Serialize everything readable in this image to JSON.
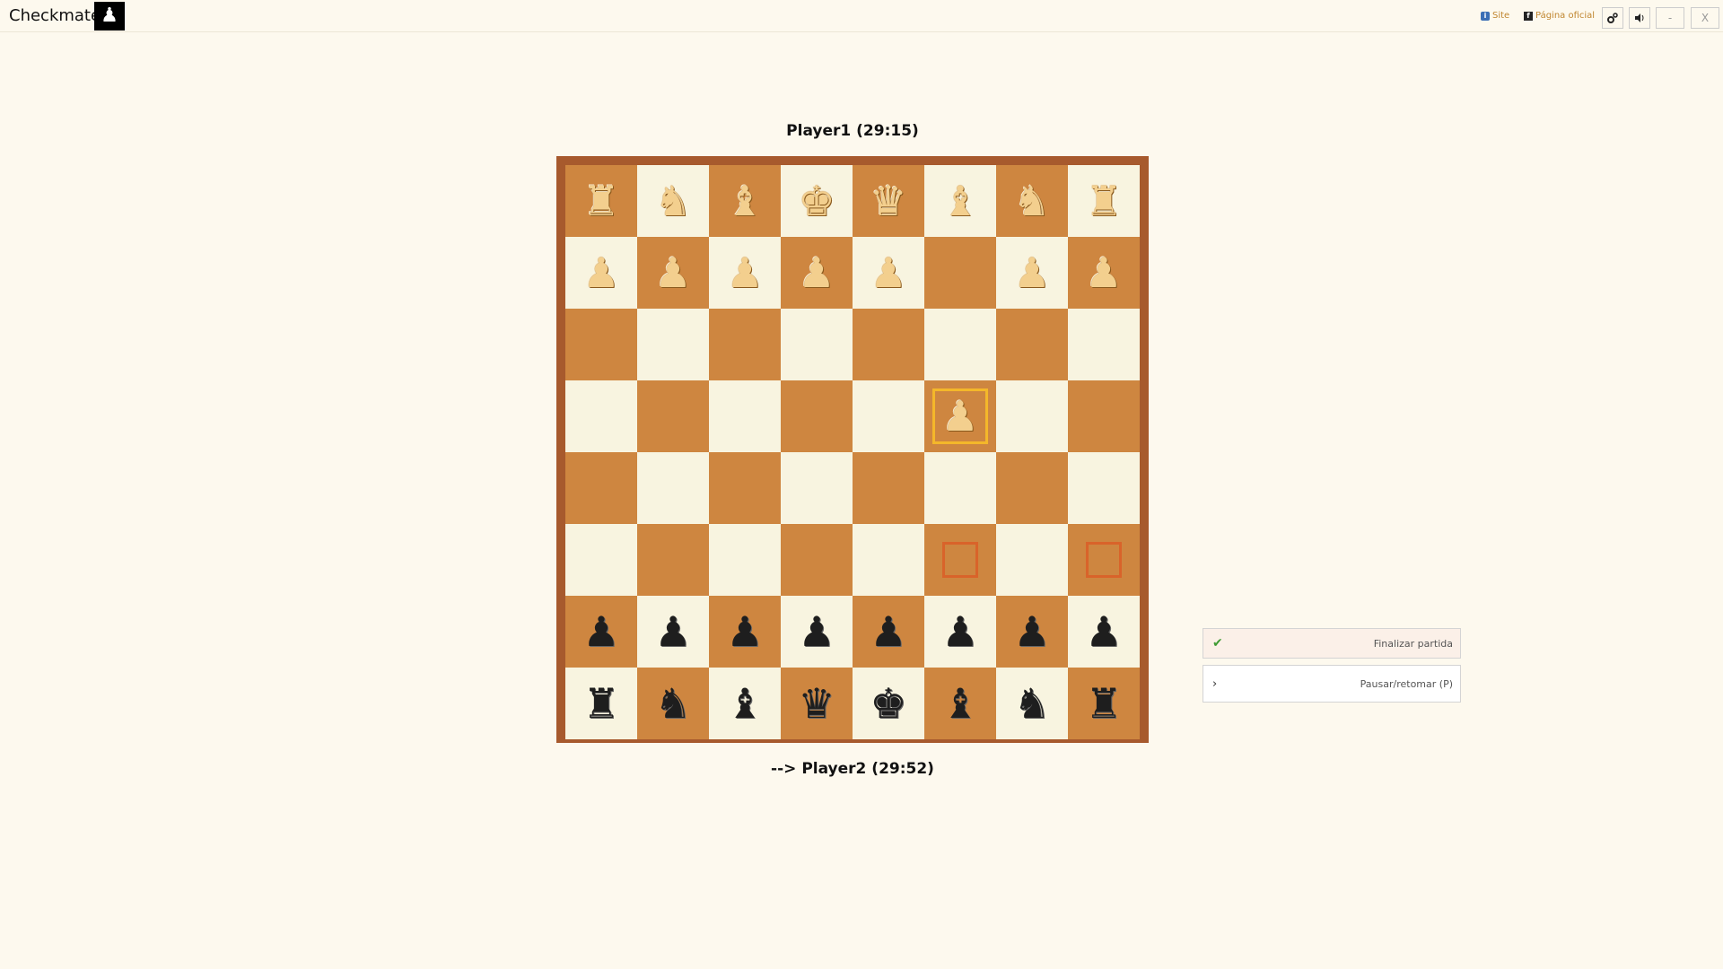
{
  "app": {
    "title": "Checkmate!",
    "logo_glyph": "♟"
  },
  "topbar": {
    "site_label": "Site",
    "facebook_label": "Página oficial",
    "settings_icon": "gear-icon",
    "sound_icon": "speaker-icon",
    "minimize_label": "-",
    "close_label": "X"
  },
  "players": {
    "top": "Player1 (29:15)",
    "bottom": "--> Player2 (29:52)"
  },
  "board": {
    "colors": {
      "light": "#f8f4e0",
      "dark": "#ce8640",
      "frame": "#a75a2d",
      "selected": "#f4b72a",
      "hint": "#d9632a"
    },
    "rows": [
      [
        "wR",
        "wN",
        "wB",
        "wK",
        "wQ",
        "wB",
        "wN",
        "wR"
      ],
      [
        "wP",
        "wP",
        "wP",
        "wP",
        "wP",
        "",
        "wP",
        "wP"
      ],
      [
        "",
        "",
        "",
        "",
        "",
        "",
        "",
        ""
      ],
      [
        "",
        "",
        "",
        "",
        "",
        "wP",
        "",
        ""
      ],
      [
        "",
        "",
        "",
        "",
        "",
        "",
        "",
        ""
      ],
      [
        "",
        "",
        "",
        "",
        "",
        "",
        "",
        ""
      ],
      [
        "bP",
        "bP",
        "bP",
        "bP",
        "bP",
        "bP",
        "bP",
        "bP"
      ],
      [
        "bR",
        "bN",
        "bB",
        "bQ",
        "bK",
        "bB",
        "bN",
        "bR"
      ]
    ],
    "selected": [
      3,
      5
    ],
    "hints": [
      [
        5,
        5
      ],
      [
        5,
        7
      ]
    ]
  },
  "actions": {
    "end_game": "Finalizar partida",
    "pause_resume": "Pausar/retomar (P)"
  }
}
